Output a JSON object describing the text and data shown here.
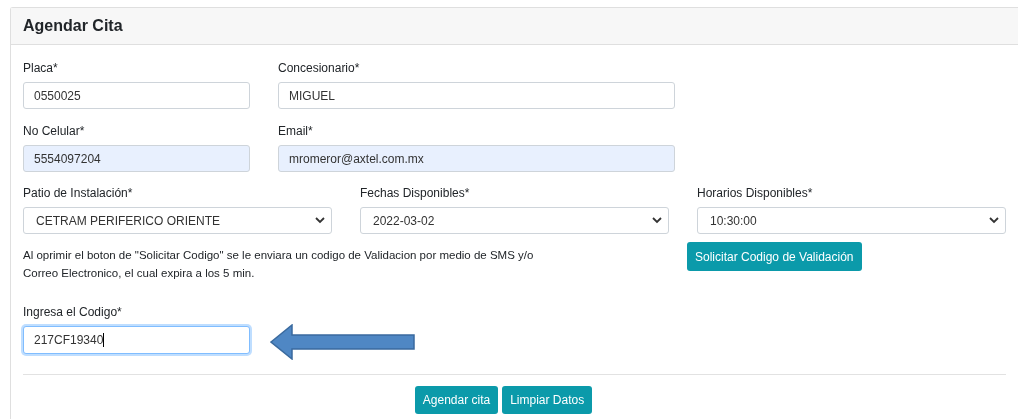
{
  "card": {
    "title": "Agendar Cita"
  },
  "row_1": [
    {
      "label": "Placa*",
      "value": "0550025",
      "autofilled": false
    },
    {
      "label": "Concesionario*",
      "value": "MIGUEL",
      "autofilled": false
    }
  ],
  "row_2": [
    {
      "label": "No Celular*",
      "value": "5554097204",
      "autofilled": true
    },
    {
      "label": "Email*",
      "value": "mromeror@axtel.com.mx",
      "autofilled": true
    }
  ],
  "selects": [
    {
      "label": "Patio de Instalación*",
      "value": "CETRAM PERIFERICO ORIENTE"
    },
    {
      "label": "Fechas Disponibles*",
      "value": "2022-03-02"
    },
    {
      "label": "Horarios Disponibles*",
      "value": "10:30:00"
    }
  ],
  "notice": "Al oprimir el boton de \"Solicitar Codigo\" se le enviara un codigo de Validacion por medio de SMS y/o Correo Electronico, el cual expira a los 5 min.",
  "request_button": "Solicitar Codigo de Validación",
  "code_field": {
    "label": "Ingresa el Codigo*",
    "value": "217CF19340",
    "focused": true
  },
  "buttons": [
    "Agendar cita",
    "Limpiar Datos"
  ]
}
